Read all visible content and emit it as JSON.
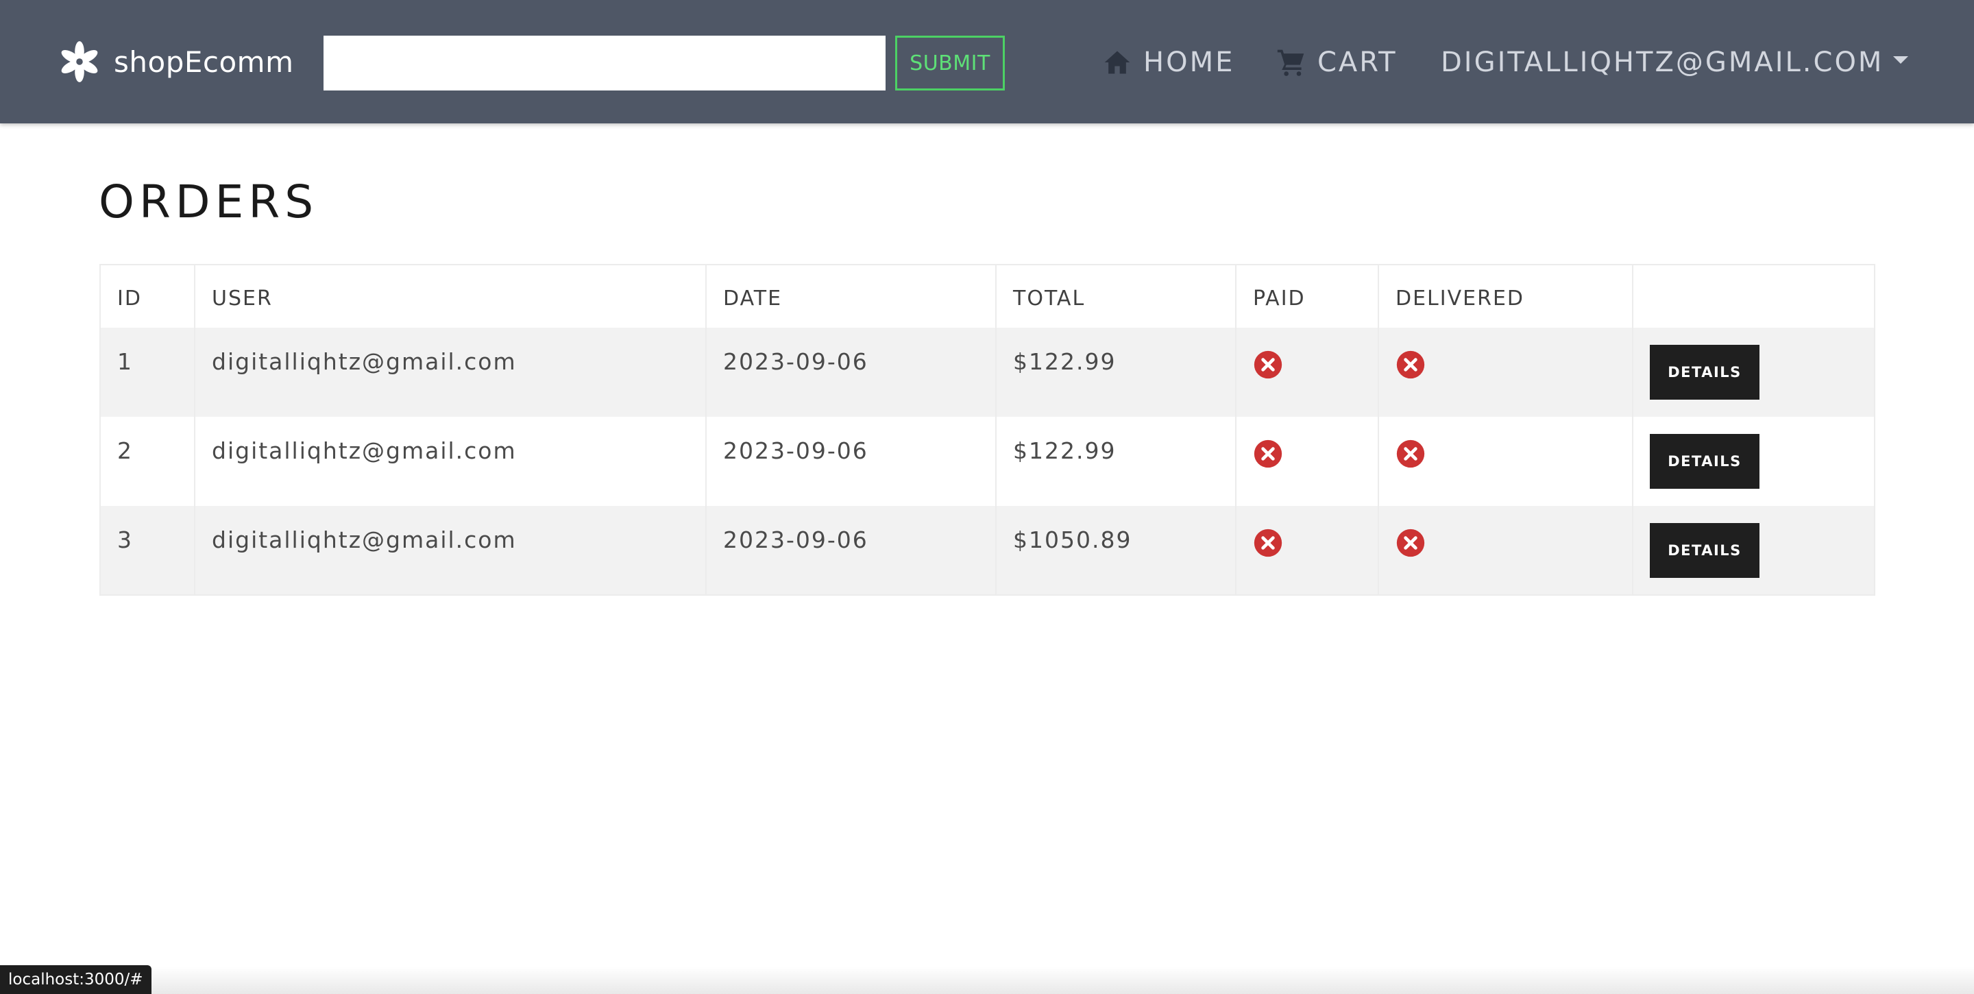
{
  "navbar": {
    "brand_name": "shopEcomm",
    "search_value": "",
    "search_placeholder": "",
    "submit_label": "SUBMIT",
    "home_label": "HOME",
    "cart_label": "CART",
    "user_label": "DIGITALLIQHTZ@GMAIL.COM"
  },
  "page": {
    "title": "ORDERS"
  },
  "table": {
    "headers": {
      "id": "ID",
      "user": "USER",
      "date": "DATE",
      "total": "TOTAL",
      "paid": "PAID",
      "delivered": "DELIVERED",
      "actions": ""
    },
    "rows": [
      {
        "id": "1",
        "user": "digitalliqhtz@gmail.com",
        "date": "2023-09-06",
        "total": "$122.99",
        "paid": false,
        "delivered": false,
        "details_label": "DETAILS"
      },
      {
        "id": "2",
        "user": "digitalliqhtz@gmail.com",
        "date": "2023-09-06",
        "total": "$122.99",
        "paid": false,
        "delivered": false,
        "details_label": "DETAILS"
      },
      {
        "id": "3",
        "user": "digitalliqhtz@gmail.com",
        "date": "2023-09-06",
        "total": "$1050.89",
        "paid": false,
        "delivered": false,
        "details_label": "DETAILS"
      }
    ]
  },
  "status_bar": {
    "url": "localhost:3000/#"
  },
  "icons": {
    "brand": "flower-logo-icon",
    "home": "home-icon",
    "cart": "cart-icon",
    "user_dropdown": "caret-down-icon",
    "not_paid": "x-circle-icon",
    "not_delivered": "x-circle-icon"
  },
  "colors": {
    "navbar_bg": "#4f5766",
    "submit_accent": "#4cd164",
    "status_negative": "#cc3333",
    "button_dark": "#1f1f1f"
  }
}
